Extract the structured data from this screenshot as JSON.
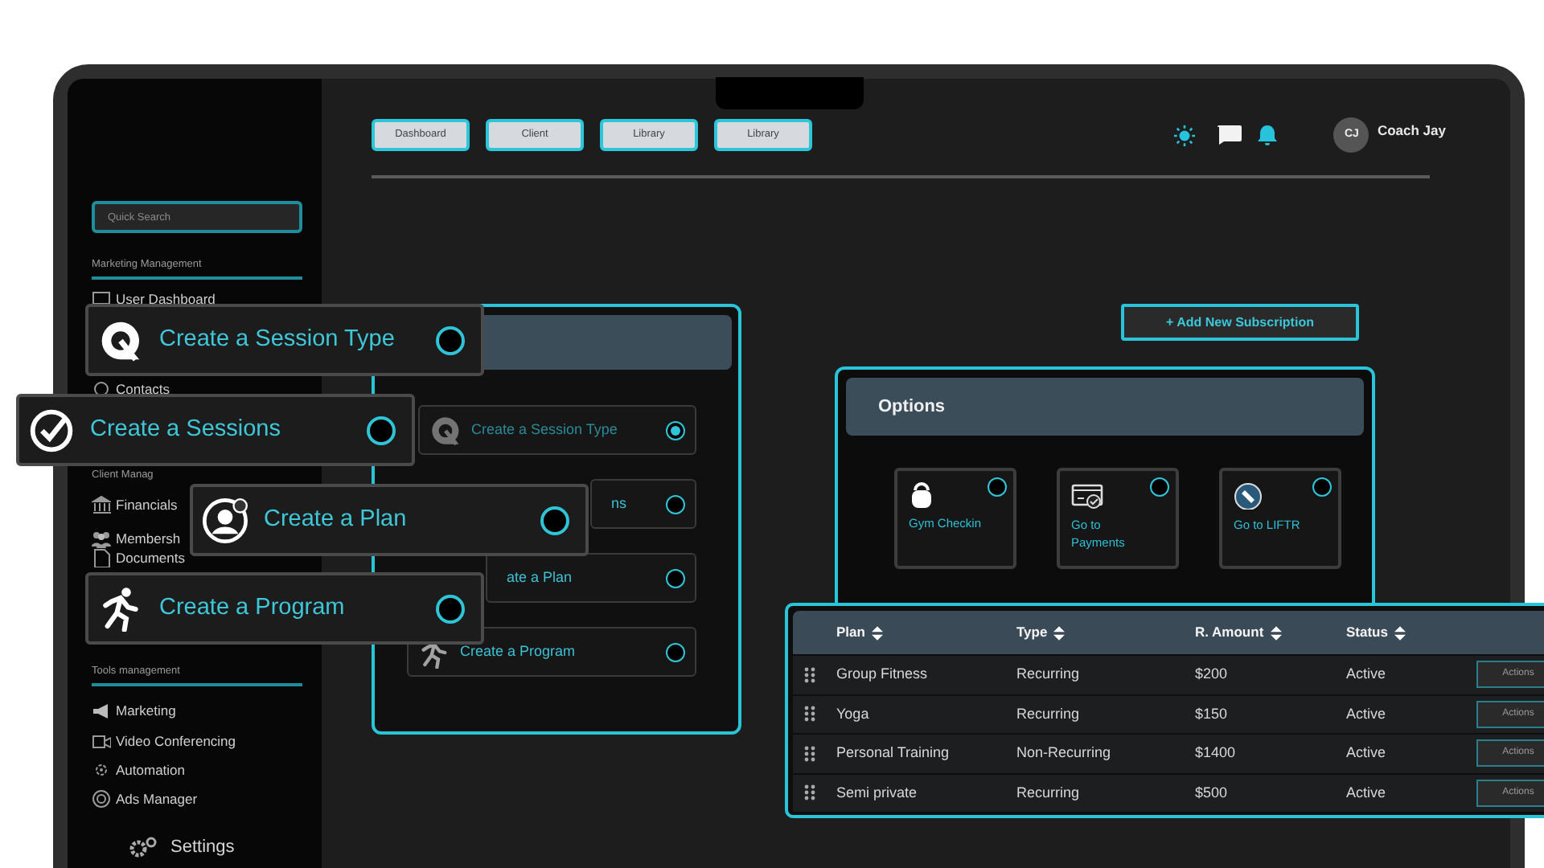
{
  "nav_tabs": [
    {
      "label": "Dashboard"
    },
    {
      "label": "Client"
    },
    {
      "label": "Library"
    },
    {
      "label": "Library"
    }
  ],
  "user": {
    "initials": "CJ",
    "name": "Coach Jay"
  },
  "sidebar": {
    "search": {
      "placeholder": "Quick Search"
    },
    "sections": [
      {
        "title": "Marketing Management",
        "items": [
          "User Dashboard",
          "Contacts"
        ]
      },
      {
        "title": "Client Manag",
        "items": [
          "Financials",
          "Membersh",
          "Documents"
        ]
      },
      {
        "title": "Tools management",
        "items": [
          "Marketing",
          "Video Conferencing",
          "Automation",
          "Ads Manager"
        ]
      }
    ],
    "settings": "Settings"
  },
  "session_panel": {
    "items": [
      {
        "label": "Create a Session Type",
        "selected": true
      },
      {
        "label": "ns",
        "selected": false
      },
      {
        "label": "ate a Plan",
        "selected": false
      },
      {
        "label": "Create a Program",
        "selected": false
      }
    ]
  },
  "add_button": "+ Add New Subscription",
  "options": {
    "title": "Options",
    "tiles": [
      {
        "label": "Gym Checkin",
        "selected": false
      },
      {
        "label": "Go to Payments",
        "selected": false
      },
      {
        "label": "Go to LIFTR",
        "selected": false
      }
    ]
  },
  "plans_table": {
    "columns": [
      "Plan",
      "Type",
      "R. Amount",
      "Status"
    ],
    "rows": [
      {
        "cells": [
          "Group Fitness",
          "Recurring",
          "$200",
          "Active"
        ],
        "action": "Actions"
      },
      {
        "cells": [
          "Yoga",
          "Recurring",
          "$150",
          "Active"
        ],
        "action": "Actions"
      },
      {
        "cells": [
          "Personal Training",
          "Non-Recurring",
          "$1400",
          "Active"
        ],
        "action": "Actions"
      },
      {
        "cells": [
          "Semi private",
          "Recurring",
          "$500",
          "Active"
        ],
        "action": "Actions"
      }
    ]
  },
  "floating_cards": [
    {
      "label": "Create a Session Type",
      "selected": false
    },
    {
      "label": "Create a Sessions",
      "selected": false
    },
    {
      "label": "Create a Plan",
      "selected": false
    },
    {
      "label": "Create a Program",
      "selected": false
    }
  ]
}
